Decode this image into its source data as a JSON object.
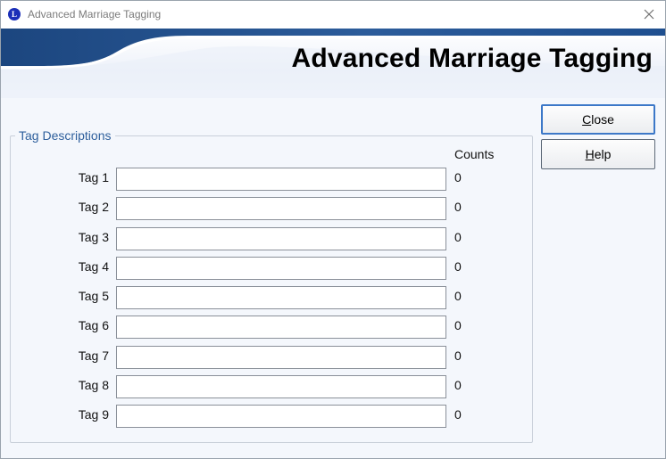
{
  "window": {
    "title": "Advanced Marriage Tagging",
    "app_icon_letter": "L",
    "close_glyph": "✕"
  },
  "banner": {
    "heading": "Advanced Marriage Tagging",
    "accent_color": "#1f4f8f"
  },
  "group": {
    "legend": "Tag Descriptions",
    "counts_header": "Counts"
  },
  "tags": [
    {
      "label": "Tag 1",
      "value": "",
      "count": "0"
    },
    {
      "label": "Tag 2",
      "value": "",
      "count": "0"
    },
    {
      "label": "Tag 3",
      "value": "",
      "count": "0"
    },
    {
      "label": "Tag 4",
      "value": "",
      "count": "0"
    },
    {
      "label": "Tag 5",
      "value": "",
      "count": "0"
    },
    {
      "label": "Tag 6",
      "value": "",
      "count": "0"
    },
    {
      "label": "Tag 7",
      "value": "",
      "count": "0"
    },
    {
      "label": "Tag 8",
      "value": "",
      "count": "0"
    },
    {
      "label": "Tag 9",
      "value": "",
      "count": "0"
    }
  ],
  "buttons": {
    "close_label": "Close",
    "close_mnemonic": "C",
    "help_label": "Help",
    "help_mnemonic": "H"
  }
}
